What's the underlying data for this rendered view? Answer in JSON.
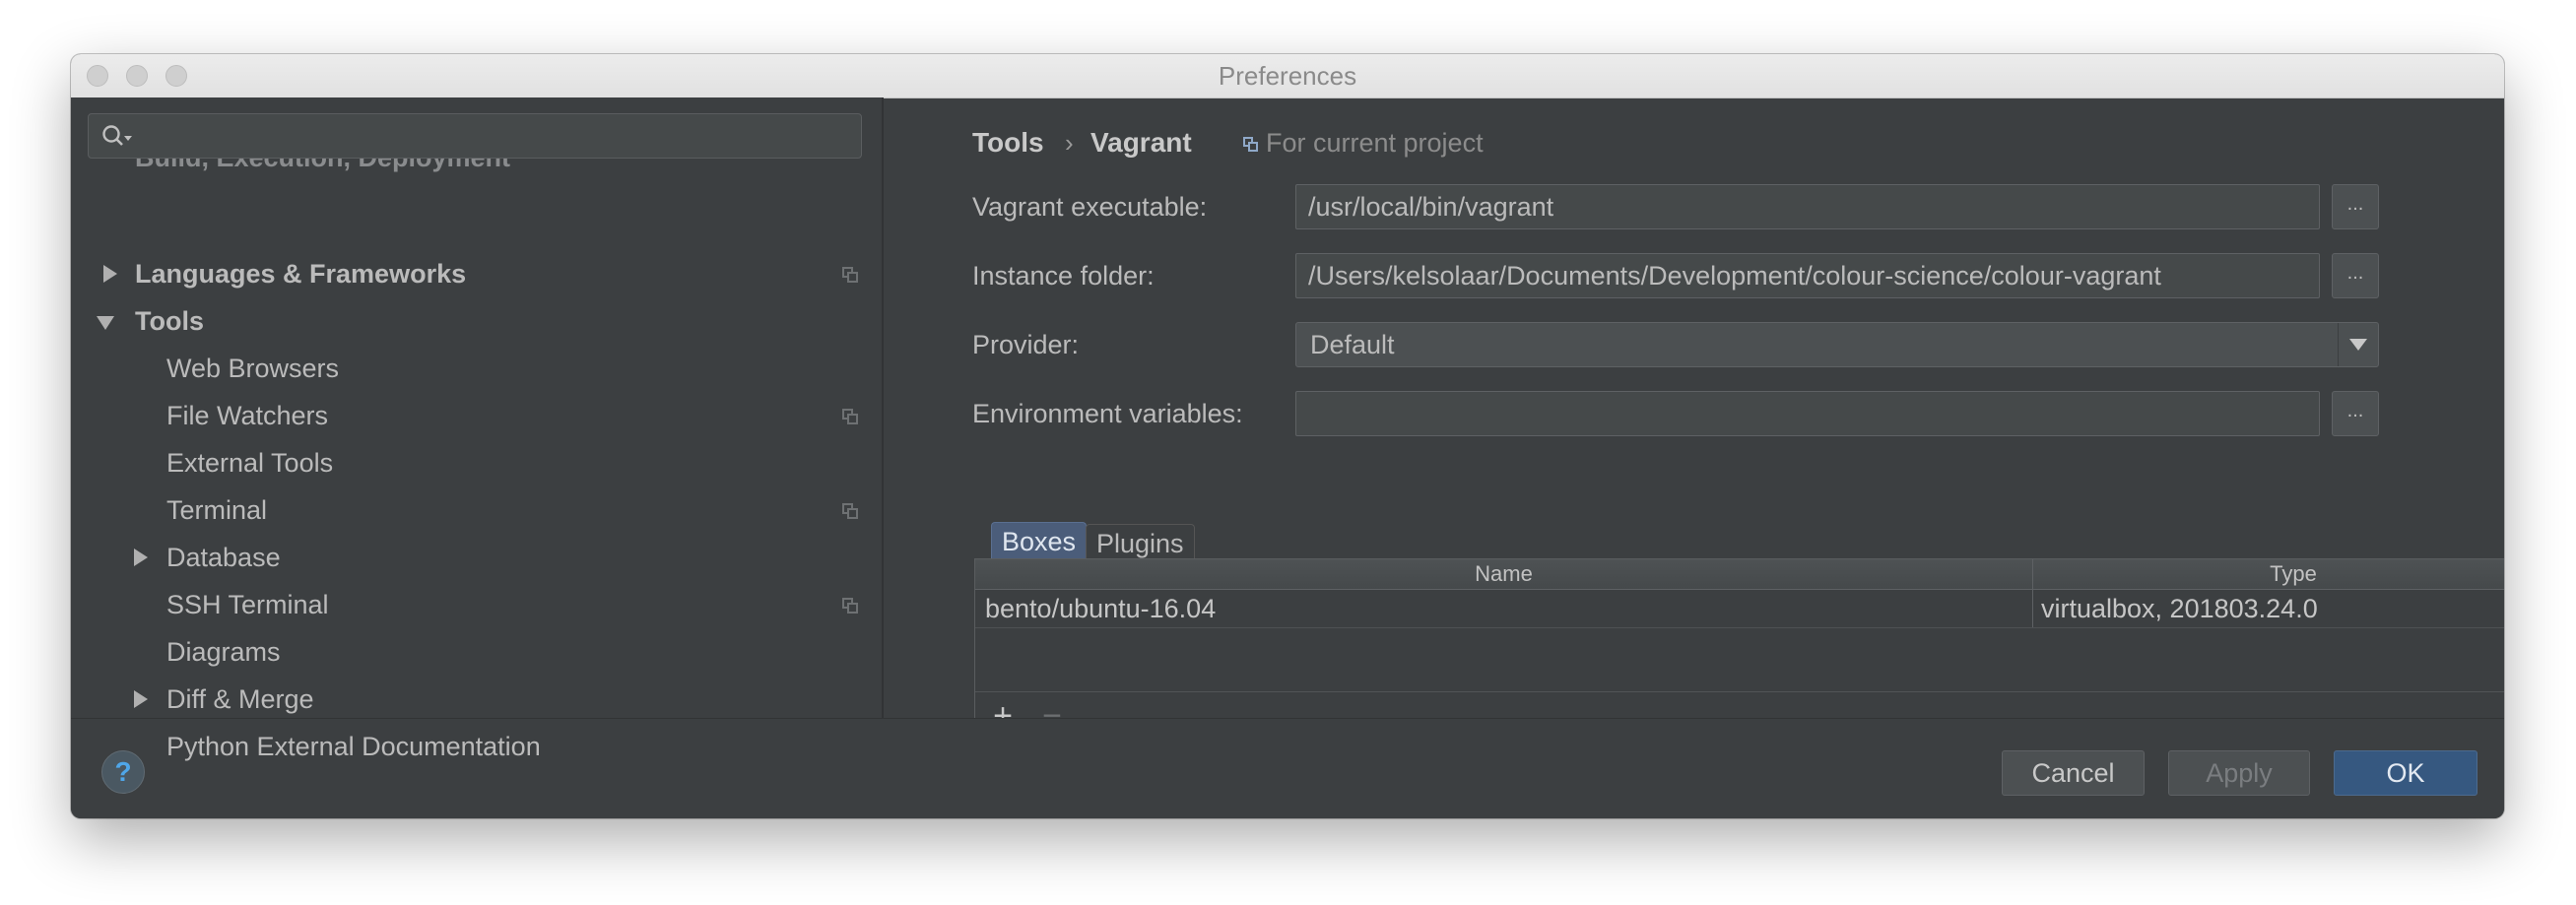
{
  "window": {
    "title": "Preferences"
  },
  "sidebar": {
    "search_placeholder": "",
    "items": [
      {
        "label": "Build, Execution, Deployment"
      },
      {
        "label": "Languages & Frameworks"
      },
      {
        "label": "Tools"
      },
      {
        "label": "Web Browsers"
      },
      {
        "label": "File Watchers"
      },
      {
        "label": "External Tools"
      },
      {
        "label": "Terminal"
      },
      {
        "label": "Database"
      },
      {
        "label": "SSH Terminal"
      },
      {
        "label": "Diagrams"
      },
      {
        "label": "Diff & Merge"
      },
      {
        "label": "Python External Documentation"
      }
    ]
  },
  "breadcrumb": {
    "parent": "Tools",
    "separator": "›",
    "current": "Vagrant",
    "scope": "For current project"
  },
  "form": {
    "executable_label": "Vagrant executable:",
    "executable_value": "/usr/local/bin/vagrant",
    "instance_label": "Instance folder:",
    "instance_value": "/Users/kelsolaar/Documents/Development/colour-science/colour-vagrant",
    "provider_label": "Provider:",
    "provider_value": "Default",
    "env_label": "Environment variables:",
    "env_value": "",
    "browse_label": "..."
  },
  "tabs": [
    {
      "label": "Boxes"
    },
    {
      "label": "Plugins"
    }
  ],
  "table": {
    "columns": [
      "Name",
      "Type"
    ],
    "rows": [
      {
        "name": "bento/ubuntu-16.04",
        "type": "virtualbox, 201803.24.0"
      }
    ],
    "add_label": "+",
    "remove_label": "−"
  },
  "footer": {
    "help_label": "?",
    "cancel": "Cancel",
    "apply": "Apply",
    "ok": "OK"
  }
}
